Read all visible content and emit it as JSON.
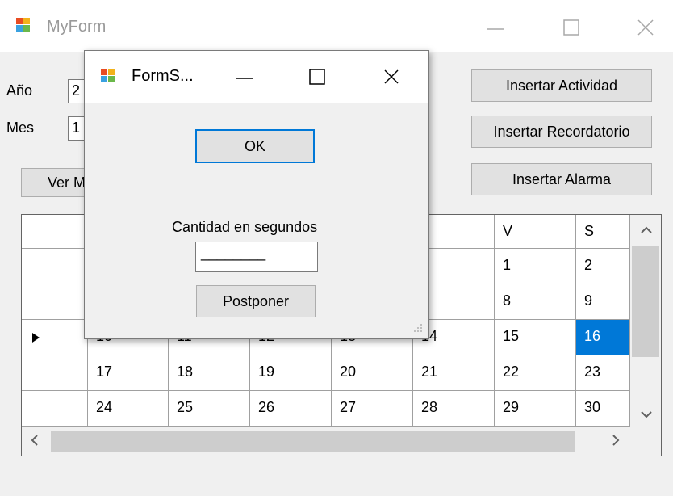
{
  "main_window": {
    "title": "MyForm",
    "labels": {
      "year": "Año",
      "month": "Mes"
    },
    "fields": {
      "year_value": "2",
      "month_value": "1"
    },
    "buttons": {
      "ver": "Ver M",
      "insert_activity": "Insertar Actividad",
      "insert_reminder": "Insertar Recordatorio",
      "insert_alarm": "Insertar Alarma"
    }
  },
  "calendar_grid": {
    "headers": [
      "",
      "",
      "",
      "",
      "",
      "V",
      "S"
    ],
    "rows": [
      {
        "cells": [
          "",
          "",
          "",
          "",
          "1",
          "2"
        ]
      },
      {
        "cells": [
          "",
          "",
          "",
          "",
          "8",
          "9"
        ]
      },
      {
        "cells": [
          "10",
          "11",
          "12",
          "13",
          "14",
          "15",
          "16"
        ],
        "current": true,
        "selected_col": 6
      },
      {
        "cells": [
          "17",
          "18",
          "19",
          "20",
          "21",
          "22",
          "23"
        ]
      },
      {
        "cells": [
          "24",
          "25",
          "26",
          "27",
          "28",
          "29",
          "30"
        ]
      }
    ]
  },
  "dialog": {
    "title": "FormS...",
    "ok_label": "OK",
    "quantity_label": "Cantidad en segundos",
    "seconds_value": "________",
    "postpone_label": "Postponer"
  },
  "colors": {
    "selection": "#0078d7",
    "focus_border": "#0078d7"
  },
  "icons": {
    "app": "app-form-icon",
    "minimize": "minimize-icon",
    "maximize": "maximize-icon",
    "close": "close-icon",
    "row_pointer": "row-pointer-icon",
    "scroll_up": "chevron-up-icon",
    "scroll_down": "chevron-down-icon",
    "scroll_left": "chevron-left-icon",
    "scroll_right": "chevron-right-icon",
    "resize_grip": "resize-grip-icon"
  }
}
